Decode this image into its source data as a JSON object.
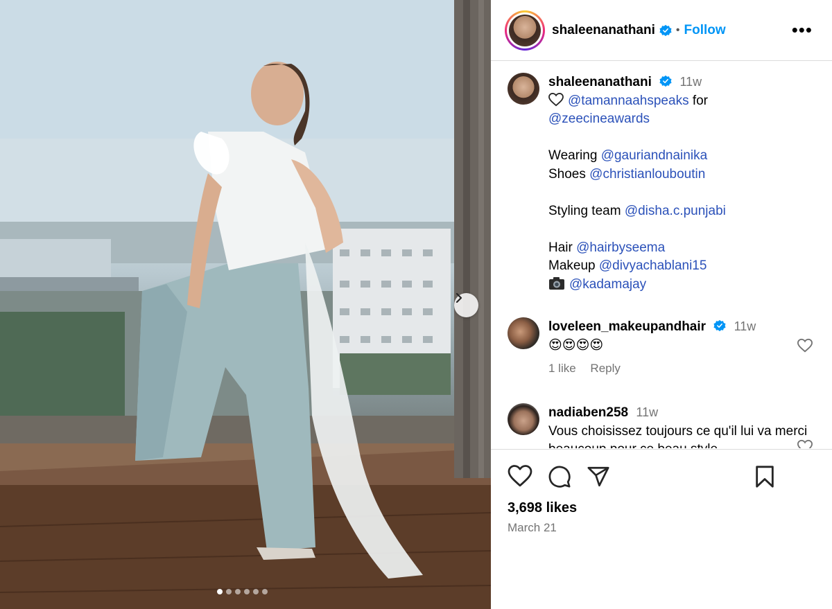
{
  "post": {
    "author": "shaleenanathani",
    "follow_label": "Follow",
    "separator": "•",
    "more_label": "•••",
    "likes": "3,698 likes",
    "date": "March 21",
    "carousel_count": 6,
    "carousel_active": 0
  },
  "caption": {
    "username": "shaleenanathani",
    "time": "11w",
    "lines": [
      {
        "prefix": "",
        "mention": "@tamannaahspeaks",
        "suffix": " for"
      },
      {
        "prefix": "",
        "mention": "@zeecineawards",
        "suffix": ""
      },
      {
        "prefix": "Wearing ",
        "mention": "@gauriandnainika",
        "suffix": ""
      },
      {
        "prefix": "Shoes ",
        "mention": "@christianlouboutin",
        "suffix": ""
      },
      {
        "prefix": "Styling team ",
        "mention": "@disha.c.punjabi",
        "suffix": ""
      },
      {
        "prefix": "Hair ",
        "mention": "@hairbyseema",
        "suffix": ""
      },
      {
        "prefix": "Makeup ",
        "mention": "@divyachablani15",
        "suffix": ""
      },
      {
        "prefix": "",
        "mention": "@kadamajay",
        "suffix": ""
      }
    ]
  },
  "comments": [
    {
      "username": "loveleen_makeupandhair",
      "time": "11w",
      "text": "😍😍😍😍",
      "likes": "1 like",
      "reply": "Reply",
      "verified": true
    },
    {
      "username": "nadiaben258",
      "time": "11w",
      "text": "Vous choisissez toujours ce qu'il lui va merci beaucoup pour ce beau style",
      "verified": false
    }
  ],
  "icons": {
    "verified": "verified-badge-icon",
    "like": "heart-icon",
    "comment": "comment-icon",
    "share": "paper-plane-icon",
    "save": "bookmark-icon",
    "next": "chevron-right-icon",
    "camera": "camera-icon"
  },
  "colors": {
    "accent": "#0095f6",
    "mention": "#00376b",
    "muted": "#737373",
    "border": "#dbdbdb"
  }
}
